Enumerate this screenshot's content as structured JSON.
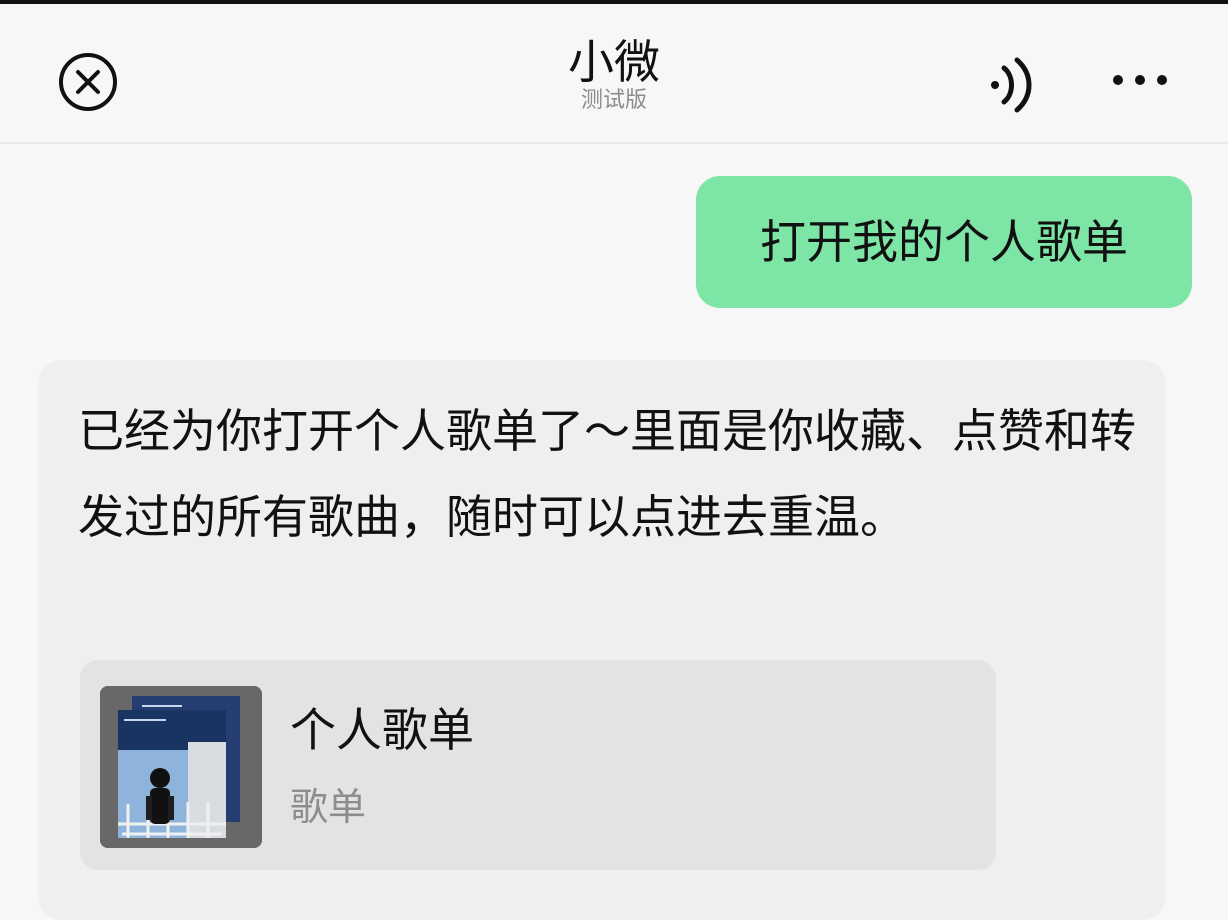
{
  "header": {
    "title": "小微",
    "subtitle": "测试版",
    "icons": {
      "close": "close-icon",
      "sound": "sound-icon",
      "more": "more-icon"
    }
  },
  "chat": {
    "user_message": "打开我的个人歌单",
    "assistant_message": "已经为你打开个人歌单了～里面是你收藏、点赞和转发过的所有歌曲，随时可以点进去重温。",
    "playlist_card": {
      "title": "个人歌单",
      "subtitle": "歌单",
      "cover_image": "playlist-cover-image"
    }
  },
  "colors": {
    "background": "#f7f7f7",
    "user_bubble": "#7de6a6",
    "assistant_bubble": "#efefef",
    "card": "#e3e3e3",
    "secondary_text": "#8d8d8d"
  }
}
